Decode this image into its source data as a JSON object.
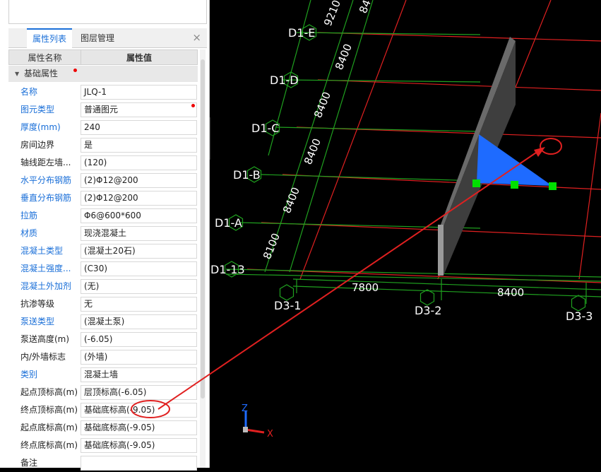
{
  "panel": {
    "tabs": [
      "属性列表",
      "图层管理"
    ],
    "close_glyph": "×",
    "col_name": "属性名称",
    "col_value": "属性值",
    "group_label": "基础属性",
    "rows": [
      {
        "name": "名称",
        "value": "JLQ-1",
        "blue": true
      },
      {
        "name": "图元类型",
        "value": "普通图元",
        "blue": true,
        "dot": true
      },
      {
        "name": "厚度(mm)",
        "value": "240",
        "blue": true
      },
      {
        "name": "房间边界",
        "value": "是",
        "blue": false
      },
      {
        "name": "轴线距左墙...",
        "value": "(120)",
        "blue": false
      },
      {
        "name": "水平分布钢筋",
        "value": "(2)Φ12@200",
        "blue": true
      },
      {
        "name": "垂直分布钢筋",
        "value": "(2)Φ12@200",
        "blue": true
      },
      {
        "name": "拉筋",
        "value": "Φ6@600*600",
        "blue": true
      },
      {
        "name": "材质",
        "value": "现浇混凝土",
        "blue": true
      },
      {
        "name": "混凝土类型",
        "value": "(混凝土20石)",
        "blue": true
      },
      {
        "name": "混凝土强度...",
        "value": "(C30)",
        "blue": true
      },
      {
        "name": "混凝土外加剂",
        "value": "(无)",
        "blue": true
      },
      {
        "name": "抗渗等级",
        "value": "无",
        "blue": false
      },
      {
        "name": "泵送类型",
        "value": "(混凝土泵)",
        "blue": true
      },
      {
        "name": "泵送高度(m)",
        "value": "(-6.05)",
        "blue": false
      },
      {
        "name": "内/外墙标志",
        "value": "(外墙)",
        "blue": false
      },
      {
        "name": "类别",
        "value": "混凝土墙",
        "blue": true
      },
      {
        "name": "起点顶标高(m)",
        "value": "层顶标高(-6.05)",
        "blue": false
      },
      {
        "name": "终点顶标高(m)",
        "value": "基础底标高(-9.05)",
        "blue": false
      },
      {
        "name": "起点底标高(m)",
        "value": "基础底标高(-9.05)",
        "blue": false
      },
      {
        "name": "终点底标高(m)",
        "value": "基础底标高(-9.05)",
        "blue": false
      },
      {
        "name": "备注",
        "value": "",
        "blue": false
      }
    ]
  },
  "viewport": {
    "axis_labels_left": [
      "D1-E",
      "D1-D",
      "D1-C",
      "D1-B",
      "D1-A",
      "D1-13"
    ],
    "axis_labels_bottom": [
      "D3-1",
      "D3-2",
      "D3-3"
    ],
    "dims_vertical": [
      "9210",
      "8400",
      "8400",
      "8400",
      "8400",
      "8400",
      "8100"
    ],
    "dims_top": [
      "8400"
    ],
    "dims_bottom": [
      "7800",
      "8400"
    ],
    "gizmo": {
      "z": "Z",
      "x": "X"
    },
    "colors": {
      "grid_red": "#e02020",
      "grid_green": "#1fa01f",
      "wall": "#5a5a5a",
      "selected": "#1e6bff",
      "grip": "#00e000"
    }
  }
}
